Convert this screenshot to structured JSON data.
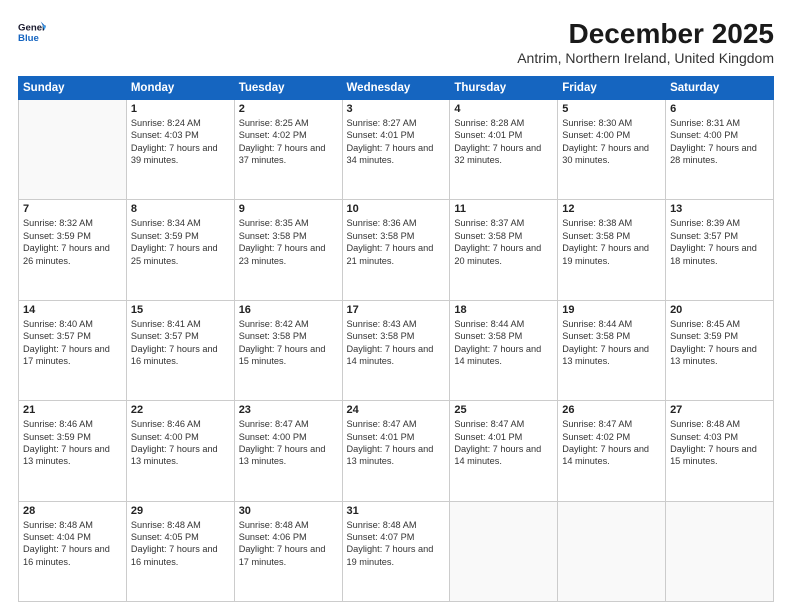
{
  "logo": {
    "line1": "General",
    "line2": "Blue"
  },
  "title": "December 2025",
  "subtitle": "Antrim, Northern Ireland, United Kingdom",
  "weekdays": [
    "Sunday",
    "Monday",
    "Tuesday",
    "Wednesday",
    "Thursday",
    "Friday",
    "Saturday"
  ],
  "weeks": [
    [
      {
        "day": "",
        "sunrise": "",
        "sunset": "",
        "daylight": ""
      },
      {
        "day": "1",
        "sunrise": "Sunrise: 8:24 AM",
        "sunset": "Sunset: 4:03 PM",
        "daylight": "Daylight: 7 hours and 39 minutes."
      },
      {
        "day": "2",
        "sunrise": "Sunrise: 8:25 AM",
        "sunset": "Sunset: 4:02 PM",
        "daylight": "Daylight: 7 hours and 37 minutes."
      },
      {
        "day": "3",
        "sunrise": "Sunrise: 8:27 AM",
        "sunset": "Sunset: 4:01 PM",
        "daylight": "Daylight: 7 hours and 34 minutes."
      },
      {
        "day": "4",
        "sunrise": "Sunrise: 8:28 AM",
        "sunset": "Sunset: 4:01 PM",
        "daylight": "Daylight: 7 hours and 32 minutes."
      },
      {
        "day": "5",
        "sunrise": "Sunrise: 8:30 AM",
        "sunset": "Sunset: 4:00 PM",
        "daylight": "Daylight: 7 hours and 30 minutes."
      },
      {
        "day": "6",
        "sunrise": "Sunrise: 8:31 AM",
        "sunset": "Sunset: 4:00 PM",
        "daylight": "Daylight: 7 hours and 28 minutes."
      }
    ],
    [
      {
        "day": "7",
        "sunrise": "Sunrise: 8:32 AM",
        "sunset": "Sunset: 3:59 PM",
        "daylight": "Daylight: 7 hours and 26 minutes."
      },
      {
        "day": "8",
        "sunrise": "Sunrise: 8:34 AM",
        "sunset": "Sunset: 3:59 PM",
        "daylight": "Daylight: 7 hours and 25 minutes."
      },
      {
        "day": "9",
        "sunrise": "Sunrise: 8:35 AM",
        "sunset": "Sunset: 3:58 PM",
        "daylight": "Daylight: 7 hours and 23 minutes."
      },
      {
        "day": "10",
        "sunrise": "Sunrise: 8:36 AM",
        "sunset": "Sunset: 3:58 PM",
        "daylight": "Daylight: 7 hours and 21 minutes."
      },
      {
        "day": "11",
        "sunrise": "Sunrise: 8:37 AM",
        "sunset": "Sunset: 3:58 PM",
        "daylight": "Daylight: 7 hours and 20 minutes."
      },
      {
        "day": "12",
        "sunrise": "Sunrise: 8:38 AM",
        "sunset": "Sunset: 3:58 PM",
        "daylight": "Daylight: 7 hours and 19 minutes."
      },
      {
        "day": "13",
        "sunrise": "Sunrise: 8:39 AM",
        "sunset": "Sunset: 3:57 PM",
        "daylight": "Daylight: 7 hours and 18 minutes."
      }
    ],
    [
      {
        "day": "14",
        "sunrise": "Sunrise: 8:40 AM",
        "sunset": "Sunset: 3:57 PM",
        "daylight": "Daylight: 7 hours and 17 minutes."
      },
      {
        "day": "15",
        "sunrise": "Sunrise: 8:41 AM",
        "sunset": "Sunset: 3:57 PM",
        "daylight": "Daylight: 7 hours and 16 minutes."
      },
      {
        "day": "16",
        "sunrise": "Sunrise: 8:42 AM",
        "sunset": "Sunset: 3:58 PM",
        "daylight": "Daylight: 7 hours and 15 minutes."
      },
      {
        "day": "17",
        "sunrise": "Sunrise: 8:43 AM",
        "sunset": "Sunset: 3:58 PM",
        "daylight": "Daylight: 7 hours and 14 minutes."
      },
      {
        "day": "18",
        "sunrise": "Sunrise: 8:44 AM",
        "sunset": "Sunset: 3:58 PM",
        "daylight": "Daylight: 7 hours and 14 minutes."
      },
      {
        "day": "19",
        "sunrise": "Sunrise: 8:44 AM",
        "sunset": "Sunset: 3:58 PM",
        "daylight": "Daylight: 7 hours and 13 minutes."
      },
      {
        "day": "20",
        "sunrise": "Sunrise: 8:45 AM",
        "sunset": "Sunset: 3:59 PM",
        "daylight": "Daylight: 7 hours and 13 minutes."
      }
    ],
    [
      {
        "day": "21",
        "sunrise": "Sunrise: 8:46 AM",
        "sunset": "Sunset: 3:59 PM",
        "daylight": "Daylight: 7 hours and 13 minutes."
      },
      {
        "day": "22",
        "sunrise": "Sunrise: 8:46 AM",
        "sunset": "Sunset: 4:00 PM",
        "daylight": "Daylight: 7 hours and 13 minutes."
      },
      {
        "day": "23",
        "sunrise": "Sunrise: 8:47 AM",
        "sunset": "Sunset: 4:00 PM",
        "daylight": "Daylight: 7 hours and 13 minutes."
      },
      {
        "day": "24",
        "sunrise": "Sunrise: 8:47 AM",
        "sunset": "Sunset: 4:01 PM",
        "daylight": "Daylight: 7 hours and 13 minutes."
      },
      {
        "day": "25",
        "sunrise": "Sunrise: 8:47 AM",
        "sunset": "Sunset: 4:01 PM",
        "daylight": "Daylight: 7 hours and 14 minutes."
      },
      {
        "day": "26",
        "sunrise": "Sunrise: 8:47 AM",
        "sunset": "Sunset: 4:02 PM",
        "daylight": "Daylight: 7 hours and 14 minutes."
      },
      {
        "day": "27",
        "sunrise": "Sunrise: 8:48 AM",
        "sunset": "Sunset: 4:03 PM",
        "daylight": "Daylight: 7 hours and 15 minutes."
      }
    ],
    [
      {
        "day": "28",
        "sunrise": "Sunrise: 8:48 AM",
        "sunset": "Sunset: 4:04 PM",
        "daylight": "Daylight: 7 hours and 16 minutes."
      },
      {
        "day": "29",
        "sunrise": "Sunrise: 8:48 AM",
        "sunset": "Sunset: 4:05 PM",
        "daylight": "Daylight: 7 hours and 16 minutes."
      },
      {
        "day": "30",
        "sunrise": "Sunrise: 8:48 AM",
        "sunset": "Sunset: 4:06 PM",
        "daylight": "Daylight: 7 hours and 17 minutes."
      },
      {
        "day": "31",
        "sunrise": "Sunrise: 8:48 AM",
        "sunset": "Sunset: 4:07 PM",
        "daylight": "Daylight: 7 hours and 19 minutes."
      },
      {
        "day": "",
        "sunrise": "",
        "sunset": "",
        "daylight": ""
      },
      {
        "day": "",
        "sunrise": "",
        "sunset": "",
        "daylight": ""
      },
      {
        "day": "",
        "sunrise": "",
        "sunset": "",
        "daylight": ""
      }
    ]
  ]
}
